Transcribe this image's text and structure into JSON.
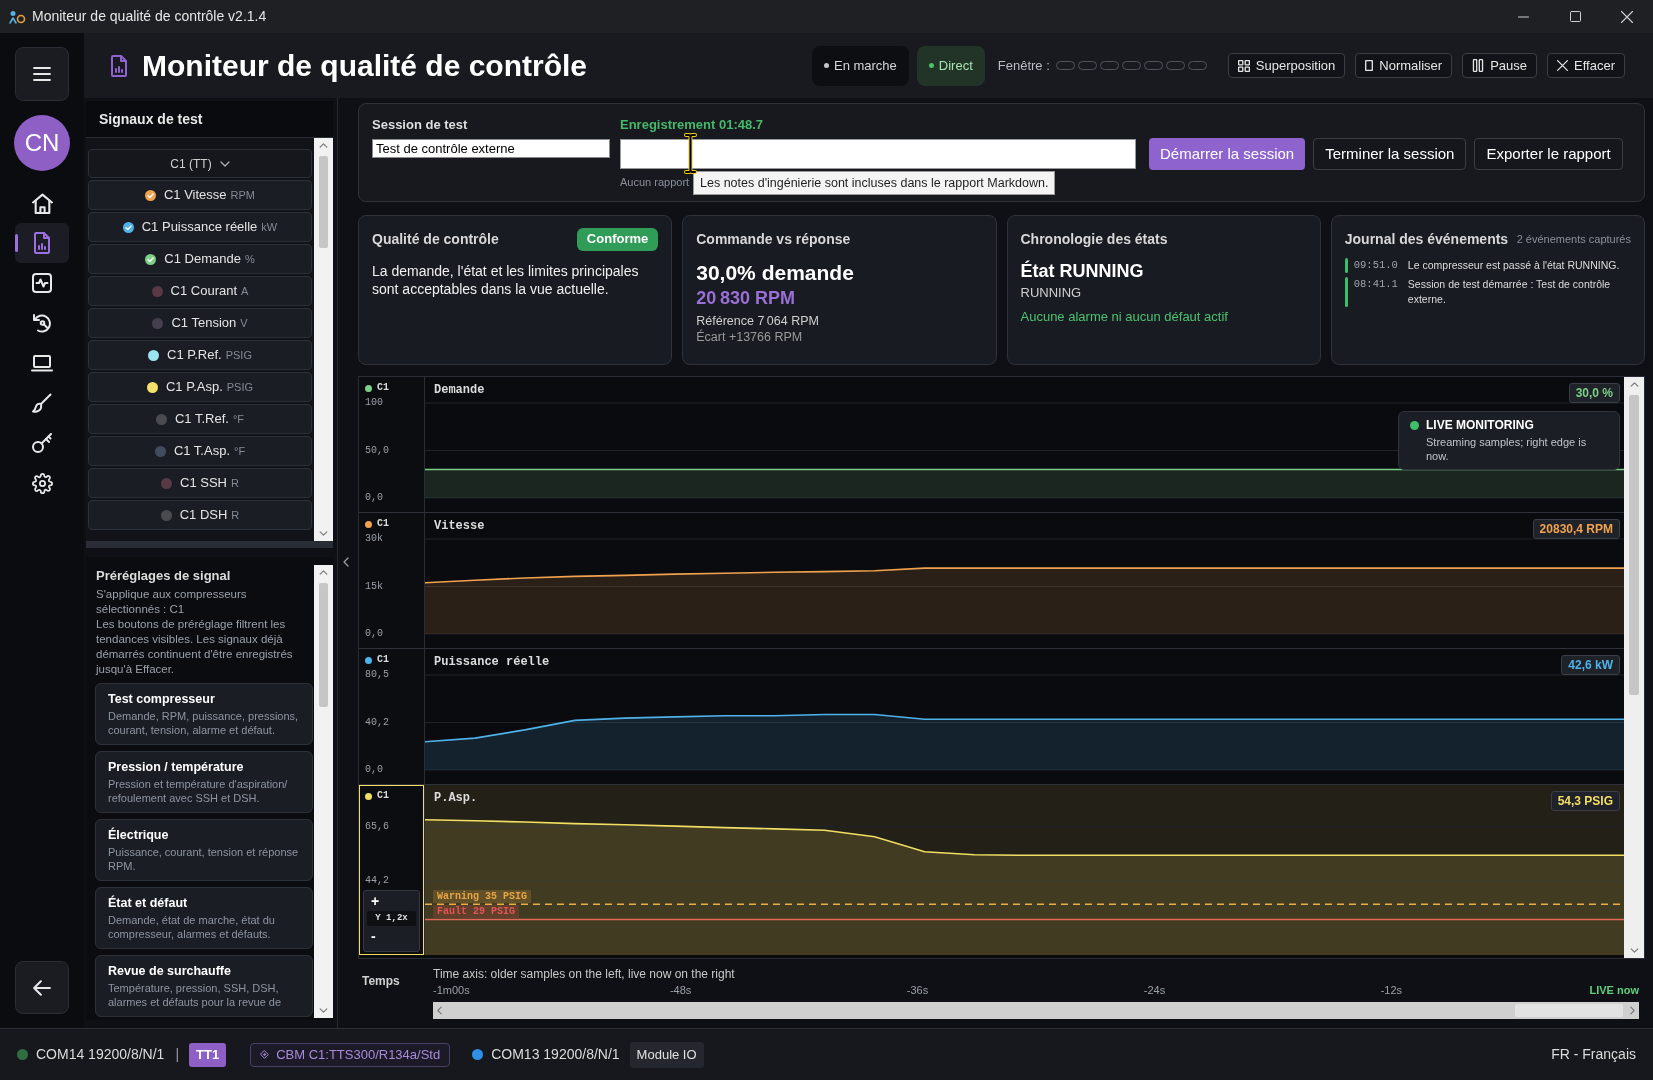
{
  "window": {
    "title": "Moniteur de qualité de contrôle v2.1.4"
  },
  "nav": {
    "avatar": "CN",
    "items": [
      {
        "kind": "home",
        "selected": false
      },
      {
        "kind": "report",
        "selected": true
      },
      {
        "kind": "activity",
        "selected": false
      },
      {
        "kind": "history",
        "selected": false
      },
      {
        "kind": "device",
        "selected": false
      },
      {
        "kind": "design",
        "selected": false
      },
      {
        "kind": "tools",
        "selected": false
      },
      {
        "kind": "settings",
        "selected": false
      }
    ]
  },
  "header": {
    "title": "Moniteur de qualité de contrôle",
    "modes": [
      {
        "label": "En marche",
        "selected": false
      },
      {
        "label": "Direct",
        "selected": true
      }
    ],
    "window_label": "Fenêtre :",
    "window_segments": [
      {
        "selected": false
      },
      {
        "selected": false
      },
      {
        "selected": false
      },
      {
        "selected": false
      },
      {
        "selected": false
      },
      {
        "selected": false
      },
      {
        "selected": false
      }
    ],
    "actions": [
      {
        "label": "Superposition",
        "kind": "overlay"
      },
      {
        "label": "Normaliser",
        "kind": "normalize"
      },
      {
        "label": "Pause",
        "kind": "pause"
      },
      {
        "label": "Effacer",
        "kind": "clear"
      }
    ]
  },
  "signals": {
    "title": "Signaux de test",
    "groups": [
      {
        "label": "C1 (TT)",
        "expanded": true,
        "children": [
          {
            "name": "C1 Vitesse",
            "unit": "RPM",
            "color": "#f0a24f",
            "checked": true
          },
          {
            "name": "C1 Puissance réelle",
            "unit": "kW",
            "color": "#4fb3ea",
            "checked": true
          },
          {
            "name": "C1 Demande",
            "unit": "%",
            "color": "#7ccf86",
            "checked": true
          },
          {
            "name": "C1 Courant",
            "unit": "A",
            "color": "#5a3845",
            "checked": false
          },
          {
            "name": "C1 Tension",
            "unit": "V",
            "color": "#463f50",
            "checked": false
          },
          {
            "name": "C1 P.Ref.",
            "unit": "PSIG",
            "color": "#9be3ee",
            "checked": false
          },
          {
            "name": "C1 P.Asp.",
            "unit": "PSIG",
            "color": "#f5e06a",
            "checked": false
          },
          {
            "name": "C1 T.Ref.",
            "unit": "°F",
            "color": "#4a4b50",
            "checked": false
          },
          {
            "name": "C1 T.Asp.",
            "unit": "°F",
            "color": "#414c5e",
            "checked": false
          },
          {
            "name": "C1 SSH",
            "unit": "R",
            "color": "#583a46",
            "checked": false
          },
          {
            "name": "C1 DSH",
            "unit": "R",
            "color": "#4a4b50",
            "checked": false
          }
        ]
      }
    ]
  },
  "presets": {
    "title": "Préréglages de signal",
    "scope": "S'applique aux compresseurs sélectionnés : C1",
    "note": "Les boutons de préréglage filtrent les tendances visibles. Les signaux déjà démarrés continuent d'être enregistrés jusqu'à Effacer.",
    "items": [
      {
        "title": "Test compresseur",
        "text": "Demande, RPM, puissance, pressions, courant, tension, alarme et défaut."
      },
      {
        "title": "Pression / température",
        "text": "Pression et température d'aspiration/ refoulement avec SSH et DSH."
      },
      {
        "title": "Électrique",
        "text": "Puissance, courant, tension et réponse RPM."
      },
      {
        "title": "État et défaut",
        "text": "Demande, état de marche, état du compresseur, alarmes et défauts."
      },
      {
        "title": "Revue de surchauffe",
        "text": "Température, pression, SSH, DSH, alarmes et défauts pour la revue de"
      }
    ]
  },
  "session": {
    "label": "Session de test",
    "name_value": "Test de contrôle externe",
    "recording": "Enregistrement 01:48.7",
    "notes_status": "Aucun rapport",
    "tooltip": "Les notes d'ingénierie sont incluses dans le rapport Markdown.",
    "buttons": [
      {
        "label": "Démarrer la session",
        "kind": "primary"
      },
      {
        "label": "Terminer la session",
        "kind": "secondary"
      },
      {
        "label": "Exporter le rapport",
        "kind": "secondary"
      }
    ]
  },
  "cards": [
    {
      "kind": "quality",
      "title": "Qualité de contrôle",
      "badge": "Conforme",
      "text": "La demande, l'état et les limites principales sont acceptables dans la vue actuelle."
    },
    {
      "kind": "command",
      "title": "Commande vs réponse",
      "headline": "30,0% demande",
      "value": "20 830 RPM",
      "lines": [
        "Référence 7 064 RPM",
        "Écart +13766 RPM"
      ]
    },
    {
      "kind": "states",
      "title": "Chronologie des états",
      "headline": "État RUNNING",
      "state": "RUNNING",
      "alarm": "Aucune alarme ni aucun défaut actif"
    },
    {
      "kind": "events",
      "title": "Journal des événements",
      "count": "2 événements capturés",
      "events": [
        {
          "time": "09:51.0",
          "text": "Le compresseur est passé à l'état RUNNING."
        },
        {
          "time": "08:41.1",
          "text": "Session de test démarrée : Test de contrôle externe."
        }
      ]
    }
  ],
  "charts": [
    {
      "selected": false,
      "badge": "30,0 %",
      "chart_data": {
        "type": "area",
        "title": "Demande",
        "categories": [
          null,
          null,
          null,
          null,
          null,
          null,
          null,
          null,
          null,
          null,
          null,
          null,
          null,
          null,
          null,
          null,
          null,
          null,
          null,
          null,
          null,
          null,
          null,
          null,
          null
        ],
        "ylim": [
          0,
          100
        ],
        "yticks": [
          {
            "value": 100,
            "label": "100"
          },
          {
            "value": 50,
            "label": "50,0"
          },
          {
            "value": 0,
            "label": "0,0"
          }
        ],
        "series": [
          {
            "name": "C1",
            "color": "#7ccf86",
            "values": [
              30,
              30,
              30,
              30,
              30,
              30,
              30,
              30,
              30,
              30,
              30,
              30,
              30,
              30,
              30,
              30,
              30,
              30,
              30,
              30,
              30,
              30,
              30,
              30,
              30
            ]
          }
        ]
      }
    },
    {
      "selected": false,
      "badge": "20830,4 RPM",
      "chart_data": {
        "type": "area",
        "title": "Vitesse",
        "categories": [
          null,
          null,
          null,
          null,
          null,
          null,
          null,
          null,
          null,
          null,
          null,
          null,
          null,
          null,
          null,
          null,
          null,
          null,
          null,
          null,
          null,
          null,
          null,
          null,
          null
        ],
        "ylim": [
          0,
          30000
        ],
        "yticks": [
          {
            "value": 30000,
            "label": "30k"
          },
          {
            "value": 15000,
            "label": "15k"
          },
          {
            "value": 0,
            "label": "0,0"
          }
        ],
        "series": [
          {
            "name": "C1",
            "color": "#f0a24f",
            "values": [
              16200,
              17000,
              17700,
              18200,
              18500,
              18900,
              19200,
              19500,
              19700,
              20000,
              20800,
              20800,
              20800,
              20800,
              20800,
              20800,
              20800,
              20800,
              20800,
              20800,
              20800,
              20800,
              20800,
              20800,
              20800
            ]
          }
        ]
      }
    },
    {
      "selected": false,
      "badge": "42,6 kW",
      "chart_data": {
        "type": "area",
        "title": "Puissance réelle",
        "categories": [
          null,
          null,
          null,
          null,
          null,
          null,
          null,
          null,
          null,
          null,
          null,
          null,
          null,
          null,
          null,
          null,
          null,
          null,
          null,
          null,
          null,
          null,
          null,
          null,
          null
        ],
        "ylim": [
          0,
          80.5
        ],
        "yticks": [
          {
            "value": 80.5,
            "label": "80,5"
          },
          {
            "value": 40.2,
            "label": "40,2"
          },
          {
            "value": 0,
            "label": "0,0"
          }
        ],
        "series": [
          {
            "name": "C1",
            "color": "#4fb3ea",
            "values": [
              24,
              27,
              34,
              42,
              44,
              45,
              46,
              46,
              47,
              47,
              43,
              43,
              43,
              43,
              43,
              43,
              43,
              43,
              43,
              43,
              43,
              43,
              43,
              43,
              43
            ]
          }
        ]
      }
    },
    {
      "selected": true,
      "badge": "54,3 PSIG",
      "zoom": {
        "increase": "+",
        "level": "Y 1,2x",
        "decrease": "-"
      },
      "chart_data": {
        "type": "area",
        "title": "P.Asp.",
        "categories": [
          null,
          null,
          null,
          null,
          null,
          null,
          null,
          null,
          null,
          null,
          null,
          null,
          null,
          null,
          null,
          null,
          null,
          null,
          null,
          null,
          null,
          null,
          null,
          null,
          null
        ],
        "ylim": [
          15,
          82
        ],
        "yticks": [
          {
            "value": 65.6,
            "label": "65,6"
          },
          {
            "value": 44.2,
            "label": "44,2"
          }
        ],
        "series": [
          {
            "name": "C1",
            "color": "#f2de63",
            "values": [
              68.3,
              67.9,
              67.4,
              66.8,
              66.3,
              65.8,
              65.2,
              64.7,
              64.2,
              61.6,
              55.7,
              54.5,
              54.3,
              54.3,
              54.3,
              54.3,
              54.3,
              54.3,
              54.3,
              54.3,
              54.3,
              54.3,
              54.3,
              54.3,
              54.3
            ]
          }
        ],
        "ref_lines": [
          {
            "axis": "y",
            "value": 35,
            "label": "Warning 35 PSIG",
            "color": "#e8a545"
          },
          {
            "axis": "y",
            "value": 29,
            "label": "Fault 29 PSIG",
            "color": "#e05555"
          }
        ]
      }
    }
  ],
  "live_toast": {
    "title": "LIVE MONITORING",
    "text": "Streaming samples; right edge is now."
  },
  "time_axis": {
    "label": "Temps",
    "caption": "Time axis: older samples on the left, live now on the right",
    "ticks": [
      {
        "label": "-1m00s",
        "kind": "time"
      },
      {
        "label": "-48s",
        "kind": "time"
      },
      {
        "label": "-36s",
        "kind": "time"
      },
      {
        "label": "-24s",
        "kind": "time"
      },
      {
        "label": "-12s",
        "kind": "time"
      },
      {
        "label": "LIVE now",
        "kind": "live"
      }
    ]
  },
  "status_bar": {
    "items": [
      {
        "kind": "port",
        "label": "COM14 19200/8/N/1",
        "color": "#2f6e40"
      },
      {
        "kind": "separator",
        "label": "|"
      },
      {
        "kind": "badge",
        "label": "TT1"
      },
      {
        "kind": "profile",
        "label": "CBM C1:TTS300/R134a/Std"
      },
      {
        "kind": "port",
        "label": "COM13 19200/8/N/1",
        "color": "#2f8fe6"
      },
      {
        "kind": "tag",
        "label": "Module IO"
      }
    ],
    "language": "FR - Français"
  }
}
